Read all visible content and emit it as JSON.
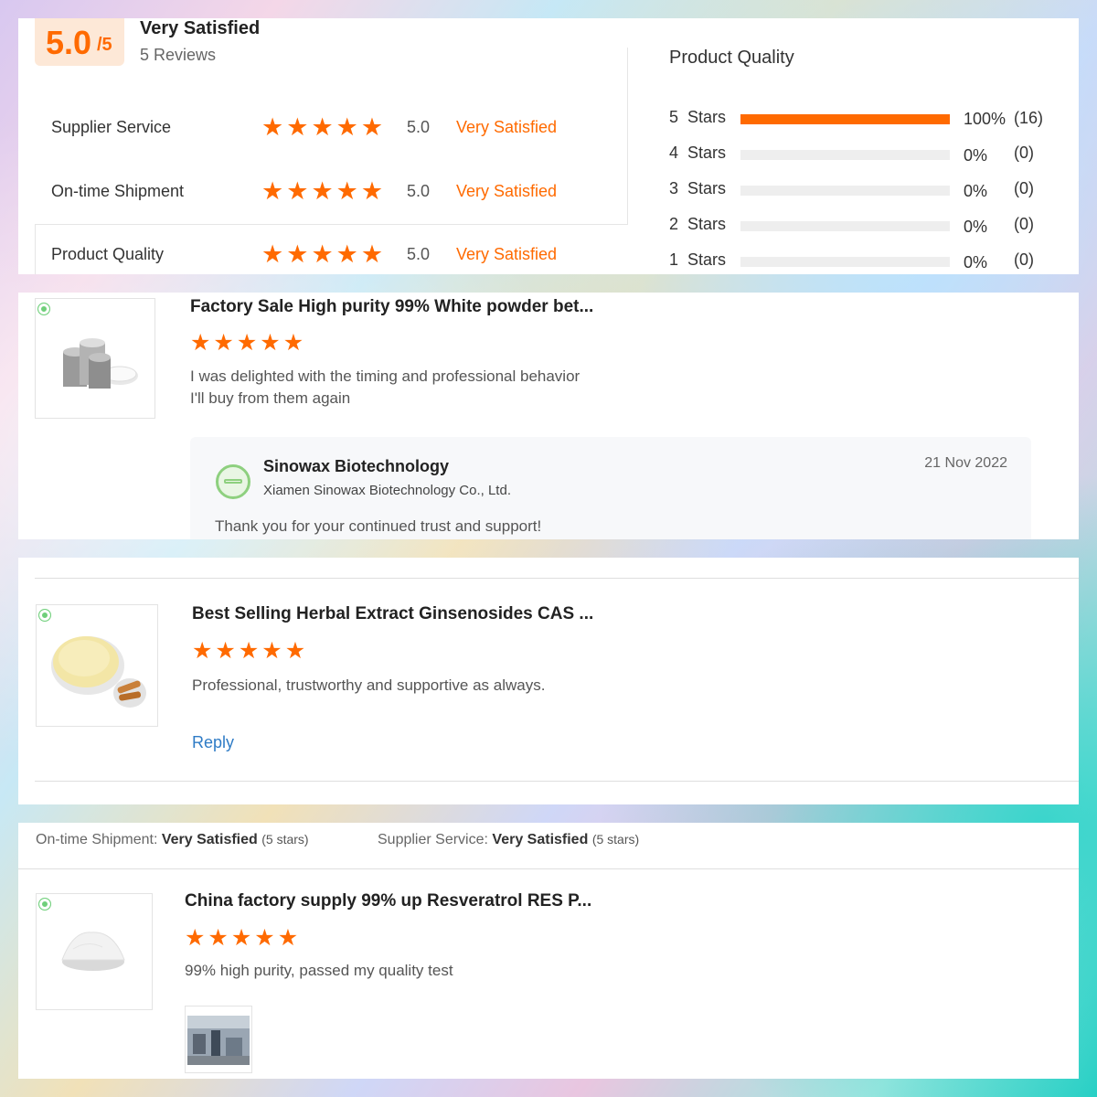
{
  "summary": {
    "score": "5.0",
    "score_max": "/5",
    "label": "Very Satisfied",
    "reviews": "5 Reviews"
  },
  "ratings": [
    {
      "label": "Supplier Service",
      "score": "5.0",
      "text": "Very Satisfied",
      "stars": 5
    },
    {
      "label": "On-time Shipment",
      "score": "5.0",
      "text": "Very Satisfied",
      "stars": 5
    },
    {
      "label": "Product Quality",
      "score": "5.0",
      "text": "Very Satisfied",
      "stars": 5
    }
  ],
  "product_quality": {
    "title": "Product Quality",
    "bars": [
      {
        "label": "5  Stars",
        "fraction": 1.0,
        "pct": "100%",
        "count": "(16)"
      },
      {
        "label": "4  Stars",
        "fraction": 0.0,
        "pct": "0%",
        "count": "(0)"
      },
      {
        "label": "3  Stars",
        "fraction": 0.0,
        "pct": "0%",
        "count": "(0)"
      },
      {
        "label": "2  Stars",
        "fraction": 0.0,
        "pct": "0%",
        "count": "(0)"
      },
      {
        "label": "1  Stars",
        "fraction": 0.0,
        "pct": "0%",
        "count": "(0)"
      }
    ]
  },
  "reviews": [
    {
      "title": "Factory Sale High purity 99% White powder bet...",
      "stars": 5,
      "text_line1": "I was delighted with the timing and professional behavior",
      "text_line2": "I'll buy from them again",
      "reply": {
        "seller": "Sinowax Biotechnology",
        "company": "Xiamen Sinowax Biotechnology Co., Ltd.",
        "date": "21 Nov 2022",
        "text": "Thank you for your continued trust and support!"
      }
    },
    {
      "title": "Best Selling Herbal Extract Ginsenosides CAS ...",
      "stars": 5,
      "text": "Professional, trustworthy and supportive as always.",
      "reply_link": "Reply"
    },
    {
      "title": "China factory supply 99% up Resveratrol RES P...",
      "stars": 5,
      "text": "99% high purity, passed my quality test"
    }
  ],
  "meta": {
    "shipment_label": "On-time Shipment:",
    "shipment_value": "Very Satisfied",
    "shipment_stars": "(5 stars)",
    "service_label": "Supplier Service:",
    "service_value": "Very Satisfied",
    "service_stars": "(5 stars)"
  },
  "colors": {
    "accent": "#ff6a00",
    "link": "#2f7cc6",
    "seller_green": "#8ed07f"
  }
}
